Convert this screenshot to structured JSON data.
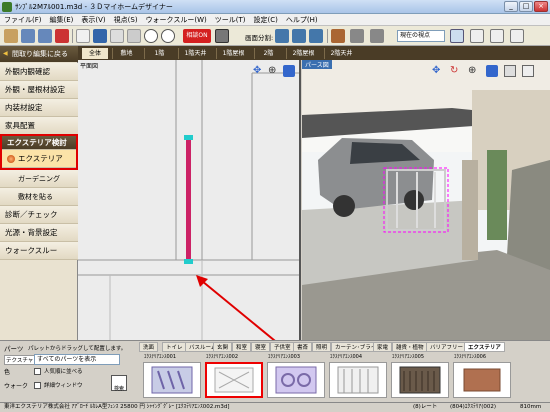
{
  "window": {
    "title": "ｻﾝﾌﾟﾙ2M7ﾙ001.m3d - ３Ｄマイホームデザイナー",
    "min": "_",
    "max": "□",
    "close": "×"
  },
  "menu": [
    "ファイル(F)",
    "編集(E)",
    "表示(V)",
    "視点(S)",
    "ウォークスルー(W)",
    "ツール(T)",
    "設定(C)",
    "ヘルプ(H)"
  ],
  "toolbar": {
    "sodan_label": "相談ON",
    "gamen_label": "画面分割:",
    "view_select": "現在の視点"
  },
  "left_panel": {
    "back_label": "間取り編集に戻る",
    "items": [
      "外観内観確認",
      "外観・屋根材設定",
      "内装材設定",
      "家具配置"
    ],
    "exterior_header": "エクステリア検討",
    "exterior_item": "エクステリア",
    "sub_items": [
      "ガーデニング",
      "敷材を貼る"
    ],
    "items2": [
      "診断／チェック",
      "光源・背景設定",
      "ウォークスルー"
    ]
  },
  "floor_tabs": [
    "全体",
    "敷地",
    "1階",
    "1階天井",
    "1階屋根",
    "2階",
    "2階屋根",
    "2階天井"
  ],
  "plan": {
    "label": "平面図"
  },
  "view3d": {
    "label": "パース図"
  },
  "parts": {
    "label": "パーツ",
    "hint": "パレットからドラッグして配置します。",
    "texture_label": "テクスチャ",
    "category_select": "すべてのパーツを表示",
    "color_label": "色",
    "wall_label": "ウォーク",
    "chk1": "人気順に並べる",
    "chk2": "詳細ウィンドウ",
    "search_label": "検索",
    "tabs": [
      "洗面",
      "トイレ",
      "バスルーム",
      "玄関",
      "和室",
      "寝室",
      "子供室",
      "書斎",
      "照明",
      "カーテン･ブラインド",
      "家電",
      "雑貨・植物",
      "バリアフリー",
      "エクステリア"
    ],
    "thumbs": [
      "ｴｸｽﾃﾘｱｴﾝｽ001",
      "ｴｸｽﾃﾘｱｴﾝｽ002",
      "ｴｸｽﾃﾘｱｴﾝｽ003",
      "ｴｸｽﾃﾘｱｴﾝｽ004",
      "ｴｸｽﾃﾘｱｴﾝｽ005",
      "ｴｸｽﾃﾘｱｴﾝｽ006"
    ]
  },
  "status": {
    "left": "東洋エクステリア株式会社 ｱｱﾞﾛｰﾁ ﾙｶﾚA型ﾌｪﾝｽ 25800 円 ｼｬｲﾝｸﾞｸﾞﾚｰ [ｴｸｽﾃﾘｱｴﾝｽ002.m3d]",
    "layer": "(8)レート",
    "coords": "(804)ｴｸｽﾃﾘｱ(002)",
    "zoom": "810mm"
  },
  "colors": {
    "accent_red": "#e00000",
    "nav_dark": "#4a3c26",
    "selection": "#ff00ff"
  }
}
